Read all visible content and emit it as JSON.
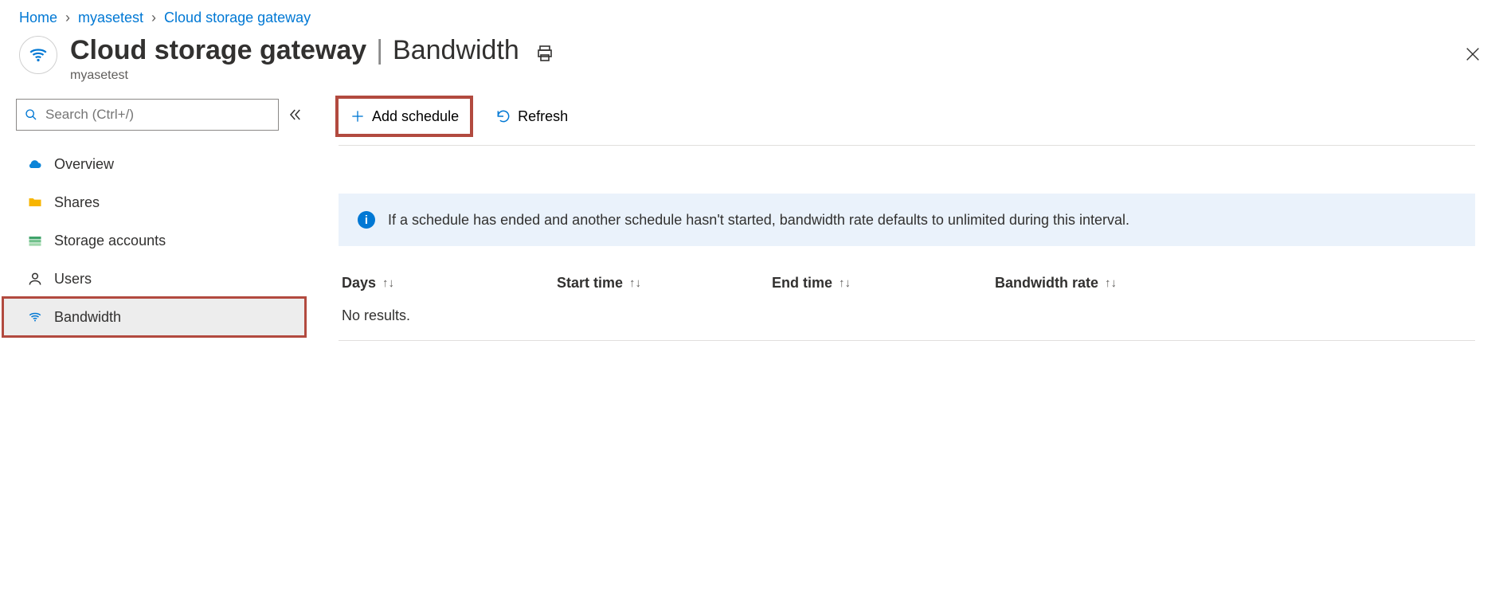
{
  "breadcrumb": {
    "items": [
      {
        "label": "Home"
      },
      {
        "label": "myasetest"
      },
      {
        "label": "Cloud storage gateway"
      }
    ]
  },
  "header": {
    "title_main": "Cloud storage gateway",
    "title_separator": "|",
    "title_section": "Bandwidth",
    "subtitle": "myasetest"
  },
  "search": {
    "placeholder": "Search (Ctrl+/)"
  },
  "sidebar": {
    "items": [
      {
        "label": "Overview",
        "icon": "cloud-icon",
        "selected": false
      },
      {
        "label": "Shares",
        "icon": "folder-icon",
        "selected": false
      },
      {
        "label": "Storage accounts",
        "icon": "storage-icon",
        "selected": false
      },
      {
        "label": "Users",
        "icon": "user-icon",
        "selected": false
      },
      {
        "label": "Bandwidth",
        "icon": "wifi-icon",
        "selected": true
      }
    ]
  },
  "toolbar": {
    "add_schedule_label": "Add schedule",
    "refresh_label": "Refresh"
  },
  "info": {
    "text": "If a schedule has ended and another schedule hasn't started, bandwidth rate defaults to unlimited during this interval."
  },
  "table": {
    "columns": [
      {
        "label": "Days"
      },
      {
        "label": "Start time"
      },
      {
        "label": "End time"
      },
      {
        "label": "Bandwidth rate"
      }
    ],
    "empty_text": "No results."
  },
  "colors": {
    "accent": "#0078d4",
    "highlight_border": "#b24a3f",
    "info_bg": "#eaf2fb"
  }
}
